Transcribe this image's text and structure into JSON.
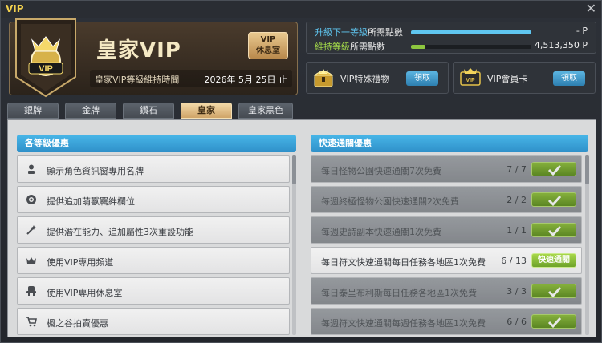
{
  "window": {
    "title": "VIP",
    "close_symbol": "✕"
  },
  "rank": {
    "name": "皇家VIP",
    "lounge_button": {
      "line1": "VIP",
      "line2": "休息室"
    },
    "time_label": "皇家VIP等級維持時間",
    "time_value": "2026年 5月 25日 止"
  },
  "points": {
    "next_level": {
      "highlight": "升級下一等級",
      "rest": "所需點數",
      "value": "- P",
      "progress": 1.0,
      "color": "#5fc6f0"
    },
    "maintain": {
      "highlight": "維持等級",
      "rest": "所需點數",
      "value": "4,513,350 P",
      "progress": 0.12,
      "color": "#8dc63f"
    }
  },
  "gift": {
    "label": "VIP特殊禮物",
    "button": "領取"
  },
  "card": {
    "label": "VIP會員卡",
    "button": "領取"
  },
  "tabs": [
    {
      "label": "銀牌",
      "active": false
    },
    {
      "label": "金牌",
      "active": false
    },
    {
      "label": "鑽石",
      "active": false
    },
    {
      "label": "皇家",
      "active": true
    },
    {
      "label": "皇家黑色",
      "active": false
    }
  ],
  "left_section": {
    "title": "各等級優惠",
    "items": [
      {
        "icon": "person-icon",
        "text": "顯示角色資訊窗專用名牌"
      },
      {
        "icon": "eye-icon",
        "text": "提供追加萌獸羈絆欄位"
      },
      {
        "icon": "magic-icon",
        "text": "提供潛在能力、追加屬性3次重設功能"
      },
      {
        "icon": "crown-icon",
        "text": "使用VIP專用頻道"
      },
      {
        "icon": "chair-icon",
        "text": "使用VIP專用休息室"
      },
      {
        "icon": "cart-icon",
        "text": "楓之谷拍賣優惠"
      }
    ]
  },
  "right_section": {
    "title": "快速通關優惠",
    "items": [
      {
        "text": "每日怪物公園快速通關7次免費",
        "count": "7 / 7",
        "state": "done"
      },
      {
        "text": "每週終極怪物公園快速通關2次免費",
        "count": "2 / 2",
        "state": "done"
      },
      {
        "text": "每週史詩副本快速通關1次免費",
        "count": "1 / 1",
        "state": "done"
      },
      {
        "text": "每日符文快速通關每日任務各地區1次免費",
        "count": "6 / 13",
        "state": "open",
        "button": "快速通關"
      },
      {
        "text": "每日泰呈布利斯每日任務各地區1次免費",
        "count": "3 / 3",
        "state": "done"
      },
      {
        "text": "每週符文快速通關每週任務各地區1次免費",
        "count": "6 / 6",
        "state": "done"
      }
    ]
  }
}
